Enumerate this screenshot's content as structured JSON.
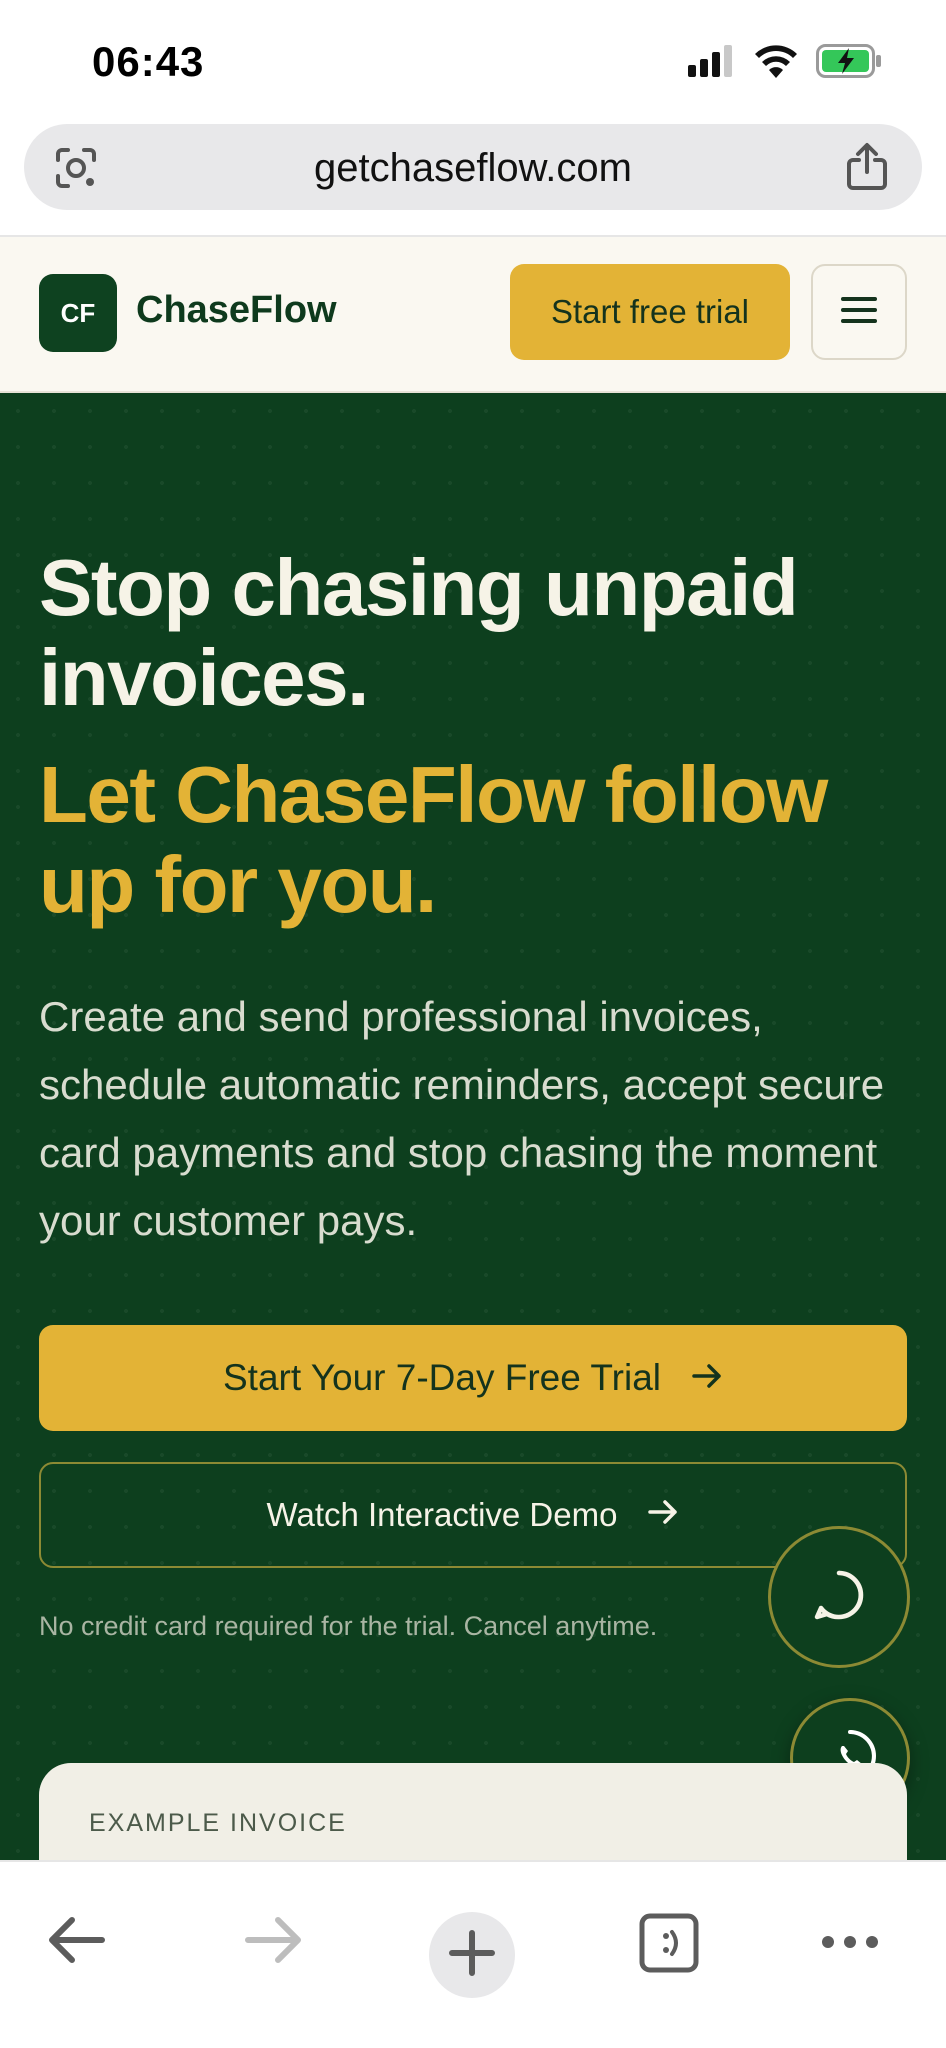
{
  "status_bar": {
    "time": "06:43"
  },
  "browser": {
    "url": "getchaseflow.com"
  },
  "header": {
    "logo_initials": "CF",
    "brand_name": "ChaseFlow",
    "cta_label": "Start free trial"
  },
  "hero": {
    "title_line": "Stop chasing unpaid invoices.",
    "title_highlight": "Let ChaseFlow follow up for you.",
    "subtitle": "Create and send professional invoices, schedule automatic reminders, accept secure card payments and stop chasing the moment your customer pays.",
    "primary_cta": "Start Your 7-Day Free Trial",
    "secondary_cta": "Watch Interactive Demo",
    "note": "No credit card required for the trial. Cancel anytime."
  },
  "invoice_card": {
    "label": "EXAMPLE INVOICE"
  },
  "colors": {
    "brand_green": "#0d3f1e",
    "accent_gold": "#e3b336",
    "cream": "#faf8f1"
  },
  "icons": {
    "status": [
      "cellular-signal-icon",
      "wifi-icon",
      "battery-charging-icon"
    ],
    "browser_bottom": [
      "back-arrow-icon",
      "forward-arrow-icon",
      "new-tab-plus-icon",
      "tabs-icon",
      "more-dots-icon"
    ],
    "floating": [
      "chat-bubble-icon",
      "whatsapp-icon"
    ]
  }
}
